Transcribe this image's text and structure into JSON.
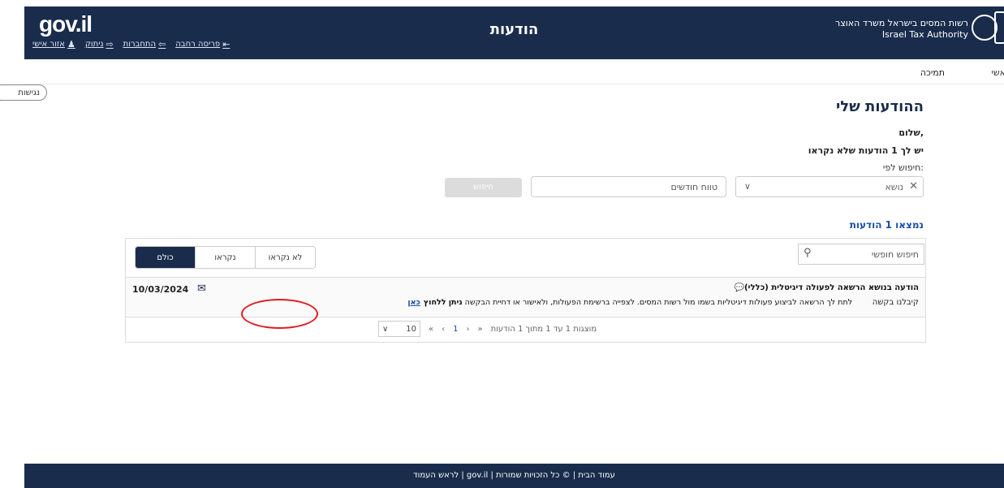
{
  "header": {
    "logo_text": "gov.il",
    "title": "הודעות",
    "authority_he": "רשות המסים בישראל משרד האוצר",
    "authority_en": "Israel Tax Authority",
    "links": {
      "personal_area": "אזור אישי",
      "logout": "ניתוק",
      "login": "התחברות",
      "exit": "פריסה רחבה"
    }
  },
  "nav": {
    "support": "תמיכה",
    "personal": "אשי"
  },
  "accessibility": "נגישות",
  "main": {
    "title": "ההודעות שלי",
    "greeting": "שלום,",
    "unread_message": "יש לך 1 הודעות שלא נקראו",
    "search_by": "חיפוש לפי:",
    "subject_placeholder": "נושא",
    "months_placeholder": "טווח חודשים",
    "search_button": "חיפוש",
    "found_count": "נמצאו 1 הודעות"
  },
  "panel": {
    "tabs": [
      {
        "label": "כולם",
        "active": true
      },
      {
        "label": "נקראו",
        "active": false
      },
      {
        "label": "לא נקראו",
        "active": false
      }
    ],
    "free_search": "חיפוש חופשי",
    "message": {
      "title": "הודעה בנושא הרשאה לפעולה דיגיטלית (כללי)",
      "status": "קיבלנו בקשה",
      "body": "לתת לך הרשאה לביצוע פעולות דיגיטליות בשמו מול רשות המסים. לצפייה ברשימת הפעולות, ולאישור או דחיית הבקשה",
      "action_prefix": "ניתן ללחוץ",
      "action_link": "כאן",
      "date": "10/03/2024"
    },
    "pager": {
      "summary": "מוצגות 1 עד 1 מתוך 1 הודעות",
      "current_page": "1",
      "page_size": "10"
    }
  },
  "footer": {
    "text": "עמוד הבית | © כל הזכויות שמורות | gov.il | לראש העמוד"
  },
  "colors": {
    "header_bg": "#1a2c4c",
    "link": "#1a4ea6",
    "highlight_circle": "#e11b22"
  }
}
